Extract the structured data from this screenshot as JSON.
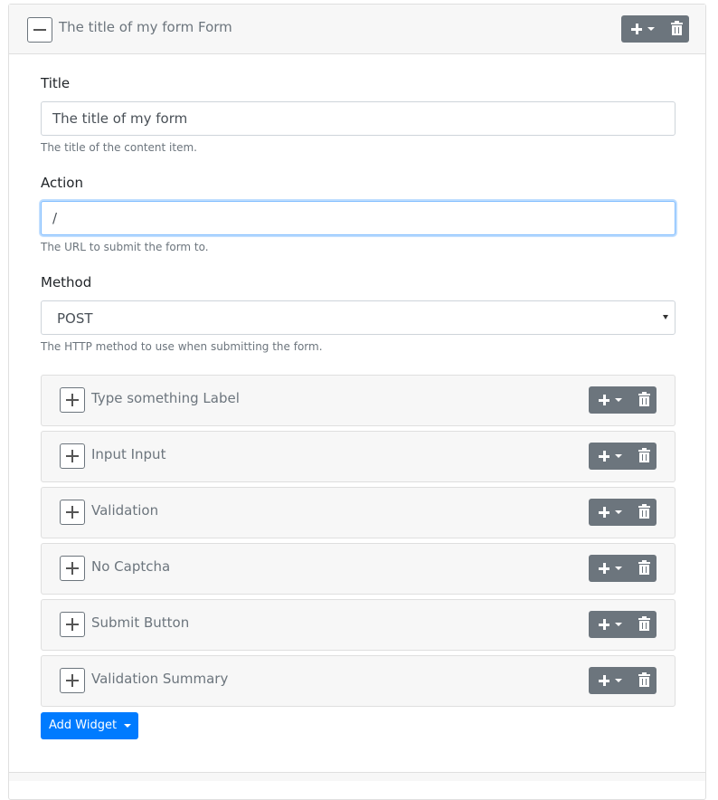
{
  "form": {
    "header_title": "The title of my form Form",
    "toggle_icon": "minus-icon"
  },
  "fields": {
    "title": {
      "label": "Title",
      "value": "The title of my form",
      "help": "The title of the content item."
    },
    "action": {
      "label": "Action",
      "value": "/",
      "help": "The URL to submit the form to."
    },
    "method": {
      "label": "Method",
      "value": "POST",
      "help": "The HTTP method to use when submitting the form."
    }
  },
  "widgets": [
    {
      "title": "Type something Label"
    },
    {
      "title": "Input Input"
    },
    {
      "title": "Validation"
    },
    {
      "title": "No Captcha"
    },
    {
      "title": "Submit Button"
    },
    {
      "title": "Validation Summary"
    }
  ],
  "add_widget_label": "Add Widget",
  "icons": {
    "expand": "plus-icon",
    "add": "plus-icon",
    "dropdown": "caret-down-icon",
    "delete": "trash-icon"
  },
  "colors": {
    "primary": "#007bff",
    "secondary": "#6c757d",
    "focus_border": "#80bdff"
  }
}
